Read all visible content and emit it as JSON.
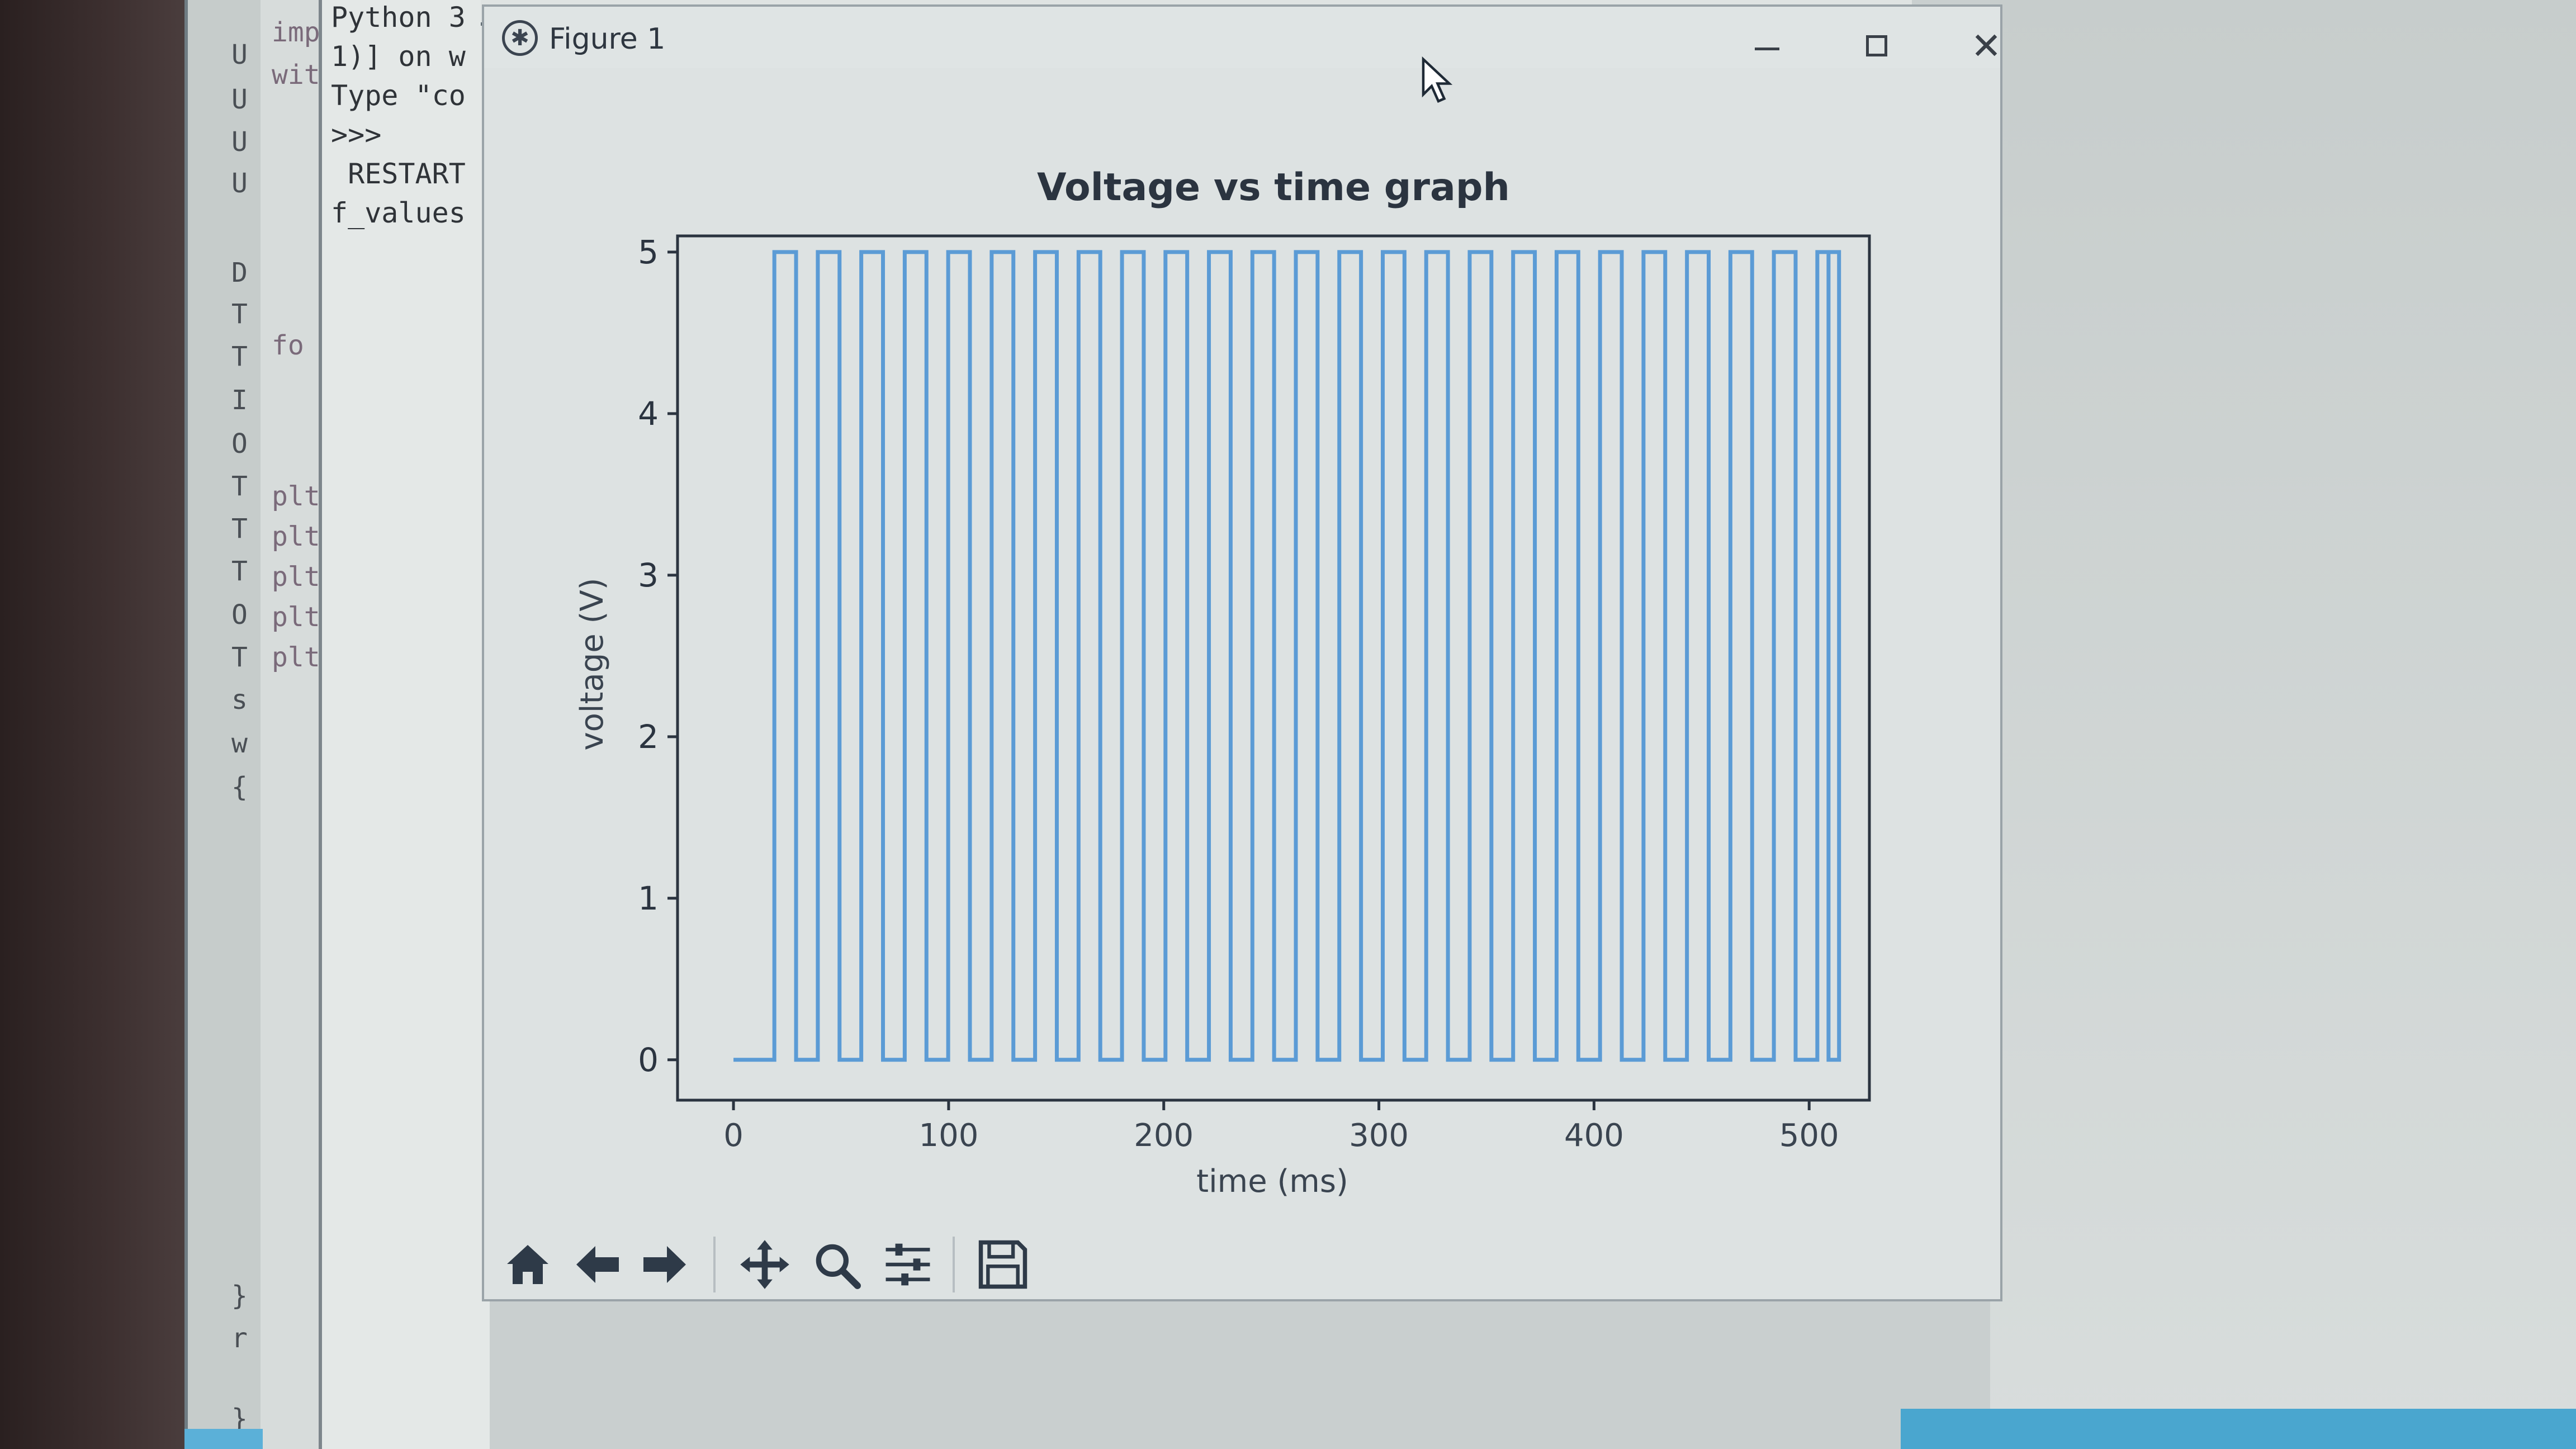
{
  "figure_window": {
    "title": "Figure 1",
    "minimize_icon": "minimize-icon",
    "maximize_icon": "maximize-icon",
    "close_icon": "close-icon"
  },
  "background_editor": {
    "gutter_chars": [
      "U",
      "U",
      "U",
      "U",
      "D",
      "T",
      "T",
      "I",
      "O",
      "T",
      "T",
      "T",
      "O",
      "T",
      "s",
      "w",
      "{",
      "}",
      "r",
      "}"
    ],
    "code_fragments": [
      "imp",
      "wit",
      "fo",
      "plt",
      "plt",
      "plt",
      "plt",
      "plt"
    ]
  },
  "background_shell": {
    "lines": [
      "Python 3",
      "1)] on w",
      "Type \"co",
      ">>>",
      " RESTART",
      "f_values"
    ]
  },
  "toolbar": {
    "buttons": [
      {
        "name": "home-button",
        "icon": "home-icon"
      },
      {
        "name": "back-button",
        "icon": "arrow-left-icon"
      },
      {
        "name": "forward-button",
        "icon": "arrow-right-icon"
      },
      {
        "name": "pan-button",
        "icon": "move-icon"
      },
      {
        "name": "zoom-button",
        "icon": "magnifier-icon"
      },
      {
        "name": "configure-subplots-button",
        "icon": "sliders-icon"
      },
      {
        "name": "save-button",
        "icon": "floppy-disk-icon"
      }
    ]
  },
  "colors": {
    "line": "#5b9bd5",
    "axes": "#2b3440",
    "text": "#2b3440",
    "window_bg": "#dde2e2"
  },
  "chart_data": {
    "type": "line",
    "title": "Voltage vs time graph",
    "xlabel": "time (ms)",
    "ylabel": "voltage (V)",
    "xlim": [
      -26,
      528
    ],
    "ylim": [
      -0.25,
      5.1
    ],
    "xticks": [
      0,
      100,
      200,
      300,
      400,
      500
    ],
    "yticks": [
      0,
      1,
      2,
      3,
      4,
      5
    ],
    "grid": false,
    "series": [
      {
        "style": "square-wave",
        "x_start": 0,
        "low_until": 19,
        "high_value": 5,
        "low_value": 0,
        "period_ms": 20.2,
        "high_ms": 10.1,
        "cycles": 25,
        "x_end": 509
      }
    ]
  }
}
